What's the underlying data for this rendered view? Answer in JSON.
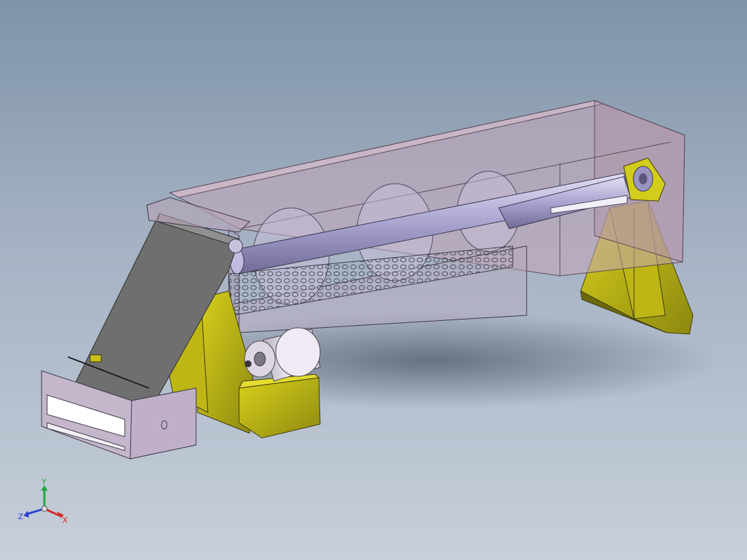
{
  "viewport": {
    "background_top": "#7f93aa",
    "background_bottom": "#c7cfda"
  },
  "model": {
    "housing_color": "#c3a5b8",
    "screw_color": "#a9a4cf",
    "support_color": "#c8c117",
    "chute_color": "#6f6f6f",
    "motor_color": "#e7e2ec"
  },
  "triad": {
    "x_label": "X",
    "y_label": "Y",
    "z_label": "Z",
    "x_color": "#d42a2a",
    "y_color": "#22a83a",
    "z_color": "#2a3fd4"
  }
}
